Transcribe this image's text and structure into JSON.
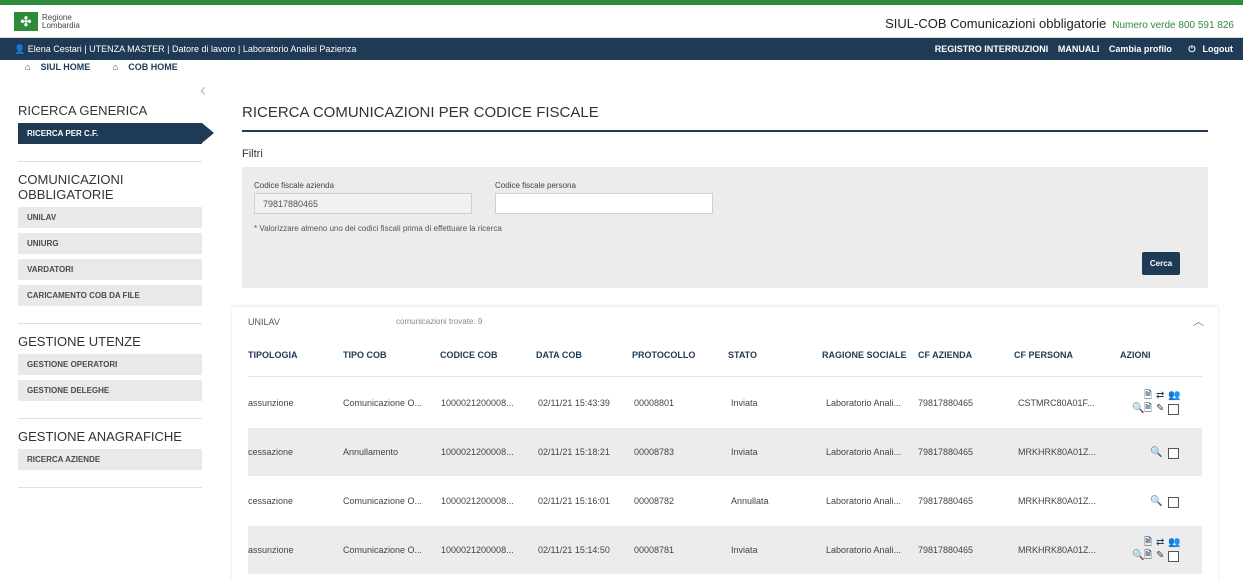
{
  "header": {
    "logo_line1": "Regione",
    "logo_line2": "Lombardia",
    "app_title": "SIUL-COB Comunicazioni obbligatorie",
    "phone": "Numero verde 800 591 826"
  },
  "userbar": {
    "user": "Elena Cestari | UTENZA MASTER | Datore di lavoro | Laboratorio Analisi Pazienza",
    "links": [
      "REGISTRO INTERRUZIONI",
      "MANUALI",
      "Cambia profilo",
      "Logout"
    ]
  },
  "breadcrumbs": [
    "SIUL HOME",
    "COB HOME"
  ],
  "sidebar": {
    "sections": [
      {
        "title": "RICERCA GENERICA",
        "items": [
          "RICERCA PER C.F."
        ]
      },
      {
        "title": "COMUNICAZIONI OBBLIGATORIE",
        "items": [
          "UNILAV",
          "UNIURG",
          "VARDATORI",
          "CARICAMENTO COB DA FILE"
        ]
      },
      {
        "title": "GESTIONE UTENZE",
        "items": [
          "GESTIONE OPERATORI",
          "GESTIONE DELEGHE"
        ]
      },
      {
        "title": "GESTIONE ANAGRAFICHE",
        "items": [
          "RICERCA AZIENDE"
        ]
      }
    ]
  },
  "main": {
    "title": "RICERCA COMUNICAZIONI PER CODICE FISCALE",
    "filters_label": "Filtri",
    "cf_azienda_label": "Codice fiscale azienda",
    "cf_azienda_value": "79817880465",
    "cf_persona_label": "Codice fiscale persona",
    "cf_persona_value": "",
    "note": "* Valorizzare almeno uno dei codici fiscali prima di effettuare la ricerca",
    "search_button": "Cerca"
  },
  "results": {
    "section": "UNILAV",
    "count": "comunicazioni trovate: 9",
    "columns": [
      "TIPOLOGIA",
      "TIPO COB",
      "CODICE COB",
      "DATA COB",
      "PROTOCOLLO",
      "STATO",
      "RAGIONE SOCIALE",
      "CF AZIENDA",
      "CF PERSONA",
      "AZIONI"
    ],
    "rows": [
      {
        "cells": [
          "assunzione",
          "Comunicazione O...",
          "1000021200008...",
          "02/11/21 15:43:39",
          "00008801",
          "Inviata",
          "Laboratorio Anali...",
          "79817880465",
          "CSTMRC80A01F..."
        ],
        "full_actions": true
      },
      {
        "cells": [
          "cessazione",
          "Annullamento",
          "1000021200008...",
          "02/11/21 15:18:21",
          "00008783",
          "Inviata",
          "Laboratorio Anali...",
          "79817880465",
          "MRKHRK80A01Z..."
        ],
        "full_actions": false
      },
      {
        "cells": [
          "cessazione",
          "Comunicazione O...",
          "1000021200008...",
          "02/11/21 15:16:01",
          "00008782",
          "Annullata",
          "Laboratorio Anali...",
          "79817880465",
          "MRKHRK80A01Z..."
        ],
        "full_actions": false
      },
      {
        "cells": [
          "assunzione",
          "Comunicazione O...",
          "1000021200008...",
          "02/11/21 15:14:50",
          "00008781",
          "Inviata",
          "Laboratorio Anali...",
          "79817880465",
          "MRKHRK80A01Z..."
        ],
        "full_actions": true
      }
    ]
  }
}
